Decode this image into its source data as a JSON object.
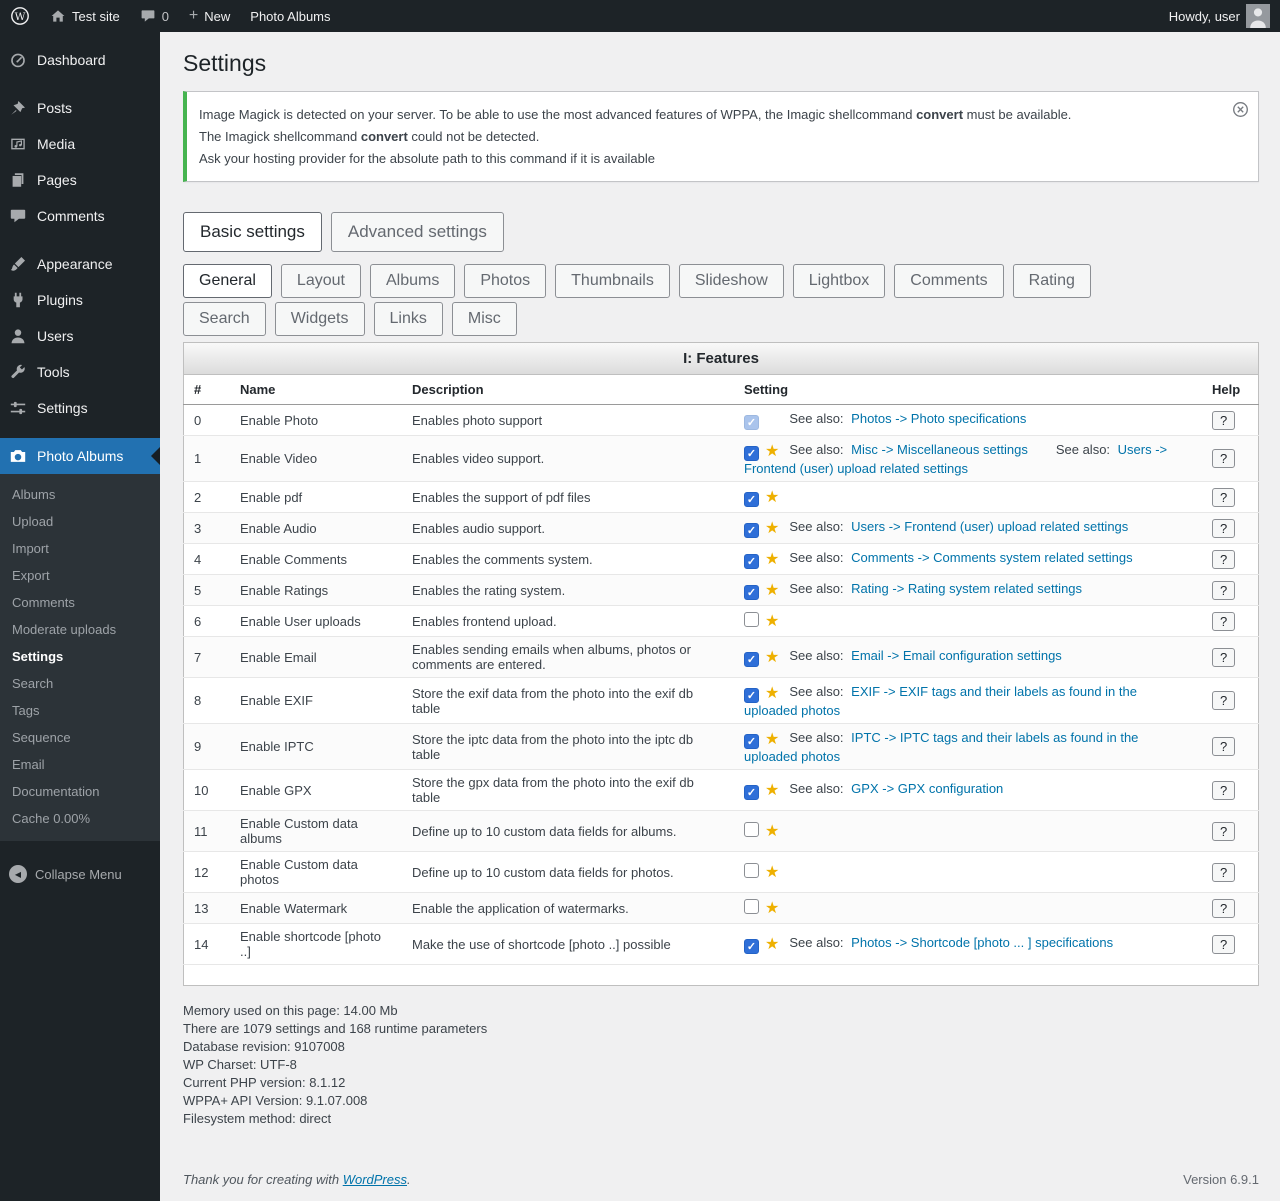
{
  "icons": {
    "check": "✓",
    "star": "★",
    "collapse_arrow": "◀"
  },
  "admin_bar": {
    "site_name": "Test site",
    "comments_count": "0",
    "new_label": "New",
    "photo_albums": "Photo Albums",
    "howdy": "Howdy, user"
  },
  "sidebar": {
    "items": [
      {
        "label": "Dashboard",
        "icon": "gauge-icon",
        "gap_after": true
      },
      {
        "label": "Posts",
        "icon": "pin-icon"
      },
      {
        "label": "Media",
        "icon": "media-icon"
      },
      {
        "label": "Pages",
        "icon": "pages-icon"
      },
      {
        "label": "Comments",
        "icon": "comments-icon",
        "gap_after": true
      },
      {
        "label": "Appearance",
        "icon": "brush-icon"
      },
      {
        "label": "Plugins",
        "icon": "plug-icon"
      },
      {
        "label": "Users",
        "icon": "user-icon"
      },
      {
        "label": "Tools",
        "icon": "tools-icon"
      },
      {
        "label": "Settings",
        "icon": "sliders-icon",
        "gap_after": true
      }
    ],
    "current_item": {
      "label": "Photo Albums",
      "icon": "camera-icon"
    },
    "submenu": [
      {
        "label": "Albums"
      },
      {
        "label": "Upload"
      },
      {
        "label": "Import"
      },
      {
        "label": "Export"
      },
      {
        "label": "Comments"
      },
      {
        "label": "Moderate uploads"
      },
      {
        "label": "Settings",
        "current": true
      },
      {
        "label": "Search"
      },
      {
        "label": "Tags"
      },
      {
        "label": "Sequence"
      },
      {
        "label": "Email"
      },
      {
        "label": "Documentation"
      },
      {
        "label": "Cache 0.00%"
      }
    ],
    "collapse_label": "Collapse Menu"
  },
  "page": {
    "title": "Settings",
    "notice_lines": [
      {
        "pre": "Image Magick is detected on your server. To be able to use the most advanced features of WPPA, the Imagic shellcommand ",
        "bold": "convert",
        "post": " must be available."
      },
      {
        "pre": "The Imagick shellcommand ",
        "bold": "convert",
        "post": " could not be detected."
      },
      {
        "pre": "Ask your hosting provider for the absolute path to this command if it is available",
        "bold": "",
        "post": ""
      }
    ],
    "primary_tabs": [
      {
        "label": "Basic settings",
        "active": true
      },
      {
        "label": "Advanced settings",
        "active": false
      }
    ],
    "section_tabs": [
      {
        "label": "General",
        "active": true
      },
      {
        "label": "Layout"
      },
      {
        "label": "Albums"
      },
      {
        "label": "Photos"
      },
      {
        "label": "Thumbnails"
      },
      {
        "label": "Slideshow"
      },
      {
        "label": "Lightbox"
      },
      {
        "label": "Comments"
      },
      {
        "label": "Rating"
      },
      {
        "label": "Search"
      },
      {
        "label": "Widgets"
      },
      {
        "label": "Links"
      },
      {
        "label": "Misc"
      }
    ],
    "table": {
      "title": "I: Features",
      "columns": [
        "#",
        "Name",
        "Description",
        "Setting",
        "Help"
      ],
      "help_label": "?",
      "rows": [
        {
          "num": "0",
          "name": "Enable Photo",
          "desc": "Enables photo support",
          "checked": true,
          "disabled": true,
          "star": false,
          "see_also": [
            {
              "label": "See also:",
              "link": "Photos -> Photo specifications"
            }
          ]
        },
        {
          "num": "1",
          "name": "Enable Video",
          "desc": "Enables video support.",
          "checked": true,
          "disabled": false,
          "star": true,
          "see_also": [
            {
              "label": "See also:",
              "link": "Misc -> Miscellaneous settings"
            },
            {
              "label": "See also:",
              "link": "Users -> Frontend (user) upload related settings"
            }
          ]
        },
        {
          "num": "2",
          "name": "Enable pdf",
          "desc": "Enables the support of pdf files",
          "checked": true,
          "disabled": false,
          "star": true,
          "see_also": []
        },
        {
          "num": "3",
          "name": "Enable Audio",
          "desc": "Enables audio support.",
          "checked": true,
          "disabled": false,
          "star": true,
          "see_also": [
            {
              "label": "See also:",
              "link": "Users -> Frontend (user) upload related settings"
            }
          ]
        },
        {
          "num": "4",
          "name": "Enable Comments",
          "desc": "Enables the comments system.",
          "checked": true,
          "disabled": false,
          "star": true,
          "see_also": [
            {
              "label": "See also:",
              "link": "Comments -> Comments system related settings"
            }
          ]
        },
        {
          "num": "5",
          "name": "Enable Ratings",
          "desc": "Enables the rating system.",
          "checked": true,
          "disabled": false,
          "star": true,
          "see_also": [
            {
              "label": "See also:",
              "link": "Rating -> Rating system related settings"
            }
          ]
        },
        {
          "num": "6",
          "name": "Enable User uploads",
          "desc": "Enables frontend upload.",
          "checked": false,
          "disabled": false,
          "star": true,
          "see_also": []
        },
        {
          "num": "7",
          "name": "Enable Email",
          "desc": "Enables sending emails when albums, photos or comments are entered.",
          "checked": true,
          "disabled": false,
          "star": true,
          "see_also": [
            {
              "label": "See also:",
              "link": "Email -> Email configuration settings"
            }
          ]
        },
        {
          "num": "8",
          "name": "Enable EXIF",
          "desc": "Store the exif data from the photo into the exif db table",
          "checked": true,
          "disabled": false,
          "star": true,
          "see_also": [
            {
              "label": "See also:",
              "link": "EXIF -> EXIF tags and their labels as found in the uploaded photos"
            }
          ]
        },
        {
          "num": "9",
          "name": "Enable IPTC",
          "desc": "Store the iptc data from the photo into the iptc db table",
          "checked": true,
          "disabled": false,
          "star": true,
          "see_also": [
            {
              "label": "See also:",
              "link": "IPTC -> IPTC tags and their labels as found in the uploaded photos"
            }
          ]
        },
        {
          "num": "10",
          "name": "Enable GPX",
          "desc": "Store the gpx data from the photo into the exif db table",
          "checked": true,
          "disabled": false,
          "star": true,
          "see_also": [
            {
              "label": "See also:",
              "link": "GPX -> GPX configuration"
            }
          ]
        },
        {
          "num": "11",
          "name": "Enable Custom data albums",
          "desc": "Define up to 10 custom data fields for albums.",
          "checked": false,
          "disabled": false,
          "star": true,
          "see_also": []
        },
        {
          "num": "12",
          "name": "Enable Custom data photos",
          "desc": "Define up to 10 custom data fields for photos.",
          "checked": false,
          "disabled": false,
          "star": true,
          "see_also": []
        },
        {
          "num": "13",
          "name": "Enable Watermark",
          "desc": "Enable the application of watermarks.",
          "checked": false,
          "disabled": false,
          "star": true,
          "see_also": []
        },
        {
          "num": "14",
          "name": "Enable shortcode [photo ..]",
          "desc": "Make the use of shortcode [photo ..] possible",
          "checked": true,
          "disabled": false,
          "star": true,
          "see_also": [
            {
              "label": "See also:",
              "link": "Photos -> Shortcode [photo ... ] specifications"
            }
          ]
        }
      ]
    },
    "stats_lines": [
      "Memory used on this page: 14.00 Mb",
      "There are 1079 settings and 168 runtime parameters",
      "Database revision: 9107008",
      "WP Charset: UTF-8",
      "Current PHP version: 8.1.12",
      "WPPA+ API Version: 9.1.07.008",
      "Filesystem method: direct"
    ],
    "footer": {
      "thanks_pre": "Thank you for creating with ",
      "thanks_link": "WordPress",
      "thanks_post": ".",
      "version": "Version 6.9.1"
    }
  }
}
